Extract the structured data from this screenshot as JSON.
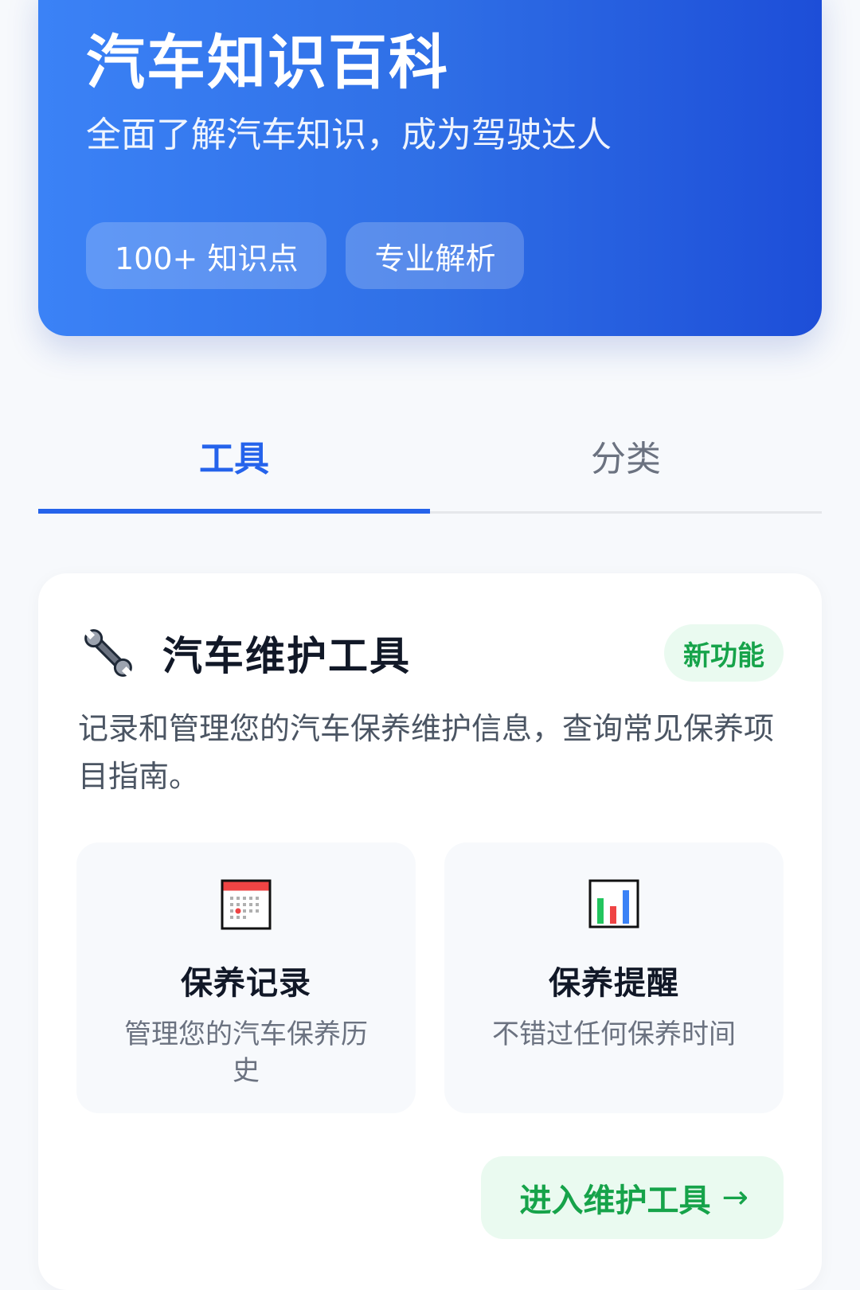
{
  "hero": {
    "title": "汽车知识百科",
    "subtitle": "全面了解汽车知识，成为驾驶达人",
    "badges": [
      "100+ 知识点",
      "专业解析"
    ]
  },
  "tabs": [
    {
      "label": "工具",
      "active": true
    },
    {
      "label": "分类",
      "active": false
    }
  ],
  "card": {
    "icon": "wrench-icon",
    "title": "汽车维护工具",
    "badge": "新功能",
    "description": "记录和管理您的汽车保养维护信息，查询常见保养项目指南。",
    "features": [
      {
        "icon": "calendar-icon",
        "title": "保养记录",
        "desc": "管理您的汽车保养历史"
      },
      {
        "icon": "bar-chart-icon",
        "title": "保养提醒",
        "desc": "不错过任何保养时间"
      }
    ],
    "button_label": "进入维护工具",
    "button_arrow": "→"
  },
  "colors": {
    "primary": "#2563eb",
    "hero_gradient_start": "#3b82f6",
    "hero_gradient_end": "#1d4ed8",
    "success": "#16a34a",
    "success_bg": "#eafaf0"
  }
}
